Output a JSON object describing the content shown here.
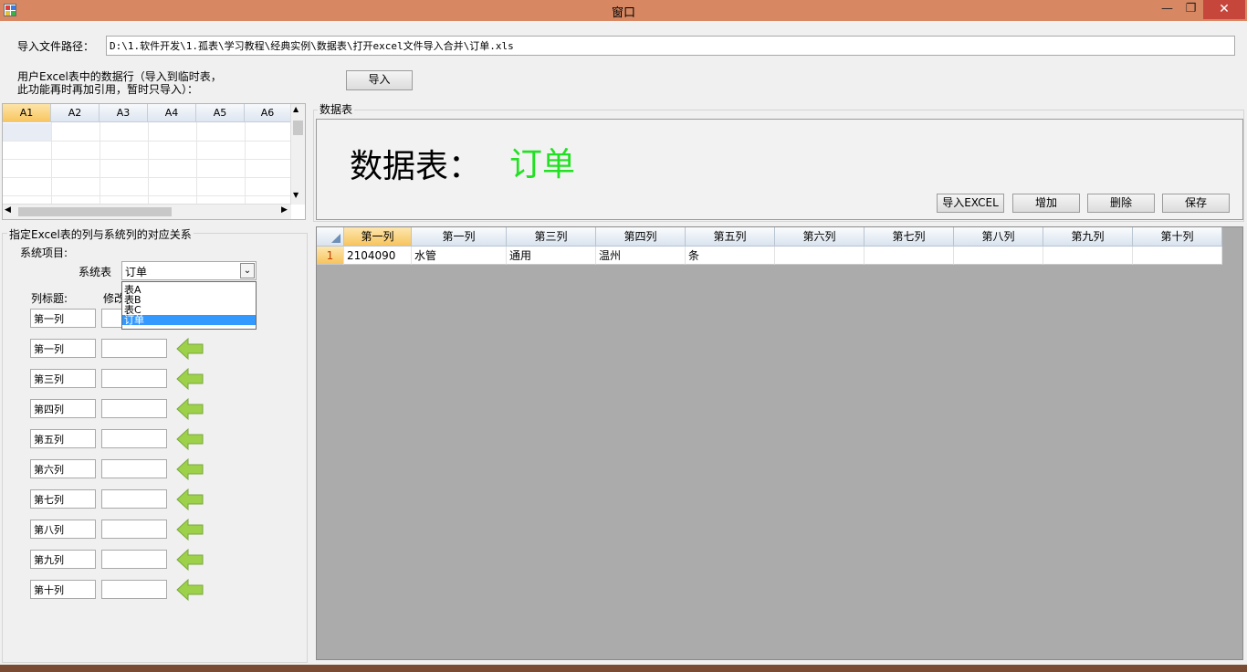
{
  "window": {
    "title": "窗口"
  },
  "import_section": {
    "path_label": "导入文件路径：",
    "path_value": "D:\\1.软件开发\\1.孤表\\学习教程\\经典实例\\数据表\\打开excel文件导入合并\\订单.xls",
    "note_line1": "用户Excel表中的数据行（导入到临时表，",
    "note_line2": "此功能再时再加引用，暂时只导入）：",
    "import_button": "导入"
  },
  "excel_preview": {
    "columns": [
      "A1",
      "A2",
      "A3",
      "A4",
      "A5",
      "A6"
    ]
  },
  "mapping": {
    "group_title": "指定Excel表的列与系统列的对应关系",
    "system_item_label": "系统项目:",
    "system_table_label": "系统表",
    "system_table_value": "订单",
    "dropdown_options": [
      "表A",
      "表B",
      "表C",
      "订单"
    ],
    "column_title_label": "列标题:",
    "modify_label": "修改",
    "rows": [
      "第一列",
      "第一列",
      "第三列",
      "第四列",
      "第五列",
      "第六列",
      "第七列",
      "第八列",
      "第九列",
      "第十列"
    ]
  },
  "data_table": {
    "group_title": "数据表",
    "heading_label": "数据表：",
    "heading_value": "订单",
    "heading_value_color": "#22e022",
    "buttons": {
      "import_excel": "导入EXCEL",
      "add": "增加",
      "delete": "删除",
      "save": "保存"
    },
    "columns": [
      "第一列",
      "第一列",
      "第三列",
      "第四列",
      "第五列",
      "第六列",
      "第七列",
      "第八列",
      "第九列",
      "第十列"
    ],
    "rows": [
      {
        "row_number": "1",
        "cells": [
          "2104090",
          "水管",
          "通用",
          "温州",
          "条",
          "",
          "",
          "",
          "",
          ""
        ]
      }
    ]
  }
}
